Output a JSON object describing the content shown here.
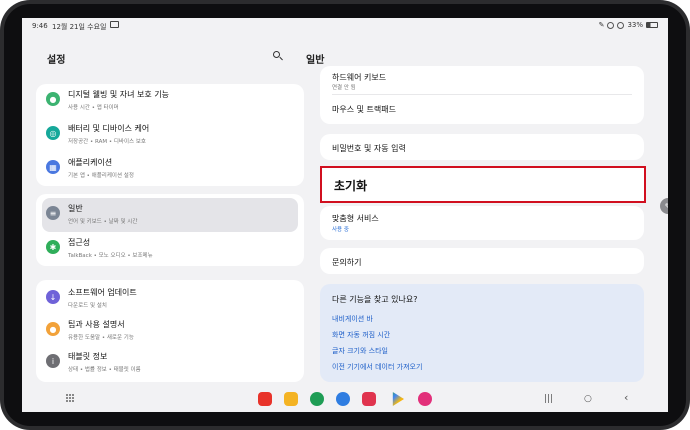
{
  "status_bar": {
    "time": "9:46",
    "date": "12월 21일 수요일",
    "battery": "33%"
  },
  "left_panel": {
    "title": "설정",
    "groups": [
      {
        "items": [
          {
            "name": "디지털 웰빙 및 자녀 보호 기능",
            "sub": "사용 시간 • 앱 타이머",
            "color": "#3cb371",
            "icon": "digital-wellbeing-icon"
          },
          {
            "name": "배터리 및 디바이스 케어",
            "sub": "저장공간 • RAM • 디바이스 보호",
            "color": "#16a89a",
            "icon": "device-care-icon"
          },
          {
            "name": "애플리케이션",
            "sub": "기본 앱 • 애플리케이션 설정",
            "color": "#4a78e0",
            "icon": "apps-icon"
          }
        ]
      },
      {
        "items": [
          {
            "name": "일반",
            "sub": "언어 및 키보드 • 날짜 및 시간",
            "color": "#7b8594",
            "icon": "general-management-icon",
            "selected": true
          },
          {
            "name": "접근성",
            "sub": "TalkBack • 모노 오디오 • 보조메뉴",
            "color": "#2fae5a",
            "icon": "accessibility-icon"
          }
        ]
      },
      {
        "items": [
          {
            "name": "소프트웨어 업데이트",
            "sub": "다운로드 및 설치",
            "color": "#6f62d8",
            "icon": "software-update-icon"
          },
          {
            "name": "팁과 사용 설명서",
            "sub": "유용한 도움말 • 새로운 기능",
            "color": "#f2a23a",
            "icon": "tips-icon"
          },
          {
            "name": "태블릿 정보",
            "sub": "상태 • 법률 정보 • 태블릿 이름",
            "color": "#6e6e73",
            "icon": "tablet-info-icon"
          }
        ]
      }
    ]
  },
  "right_panel": {
    "title": "일반",
    "hardware_keyboard": {
      "name": "하드웨어 키보드",
      "sub": "연결 안 됨"
    },
    "mouse_trackpad": "마우스 및 트랙패드",
    "password_autofill": "비밀번호 및 자동 입력",
    "reset": "초기화",
    "custom_service": {
      "name": "맞춤형 서비스",
      "sub": "사용 중"
    },
    "contact_us": "문의하기",
    "suggestions": {
      "title": "다른 기능을 찾고 있나요?",
      "links": [
        "내비게이션 바",
        "화면 자동 꺼짐 시간",
        "글자 크기와 스타일",
        "이전 기기에서 데이터 가져오기"
      ]
    }
  },
  "dock": {
    "apps": [
      {
        "icon": "samsung-notes-icon",
        "color": "#e8332a"
      },
      {
        "icon": "my-files-icon",
        "color": "#f4b323"
      },
      {
        "icon": "phone-link-icon",
        "color": "#1f9d55"
      },
      {
        "icon": "messages-icon",
        "color": "#2f7de1"
      },
      {
        "icon": "camera-icon",
        "color": "#e0344e"
      },
      {
        "icon": "play-store-icon",
        "color": "#34a853"
      },
      {
        "icon": "blossom-app-icon",
        "color": "#e2307a"
      }
    ],
    "nav": {
      "recents": "|||",
      "home": "○",
      "back": "‹"
    }
  }
}
